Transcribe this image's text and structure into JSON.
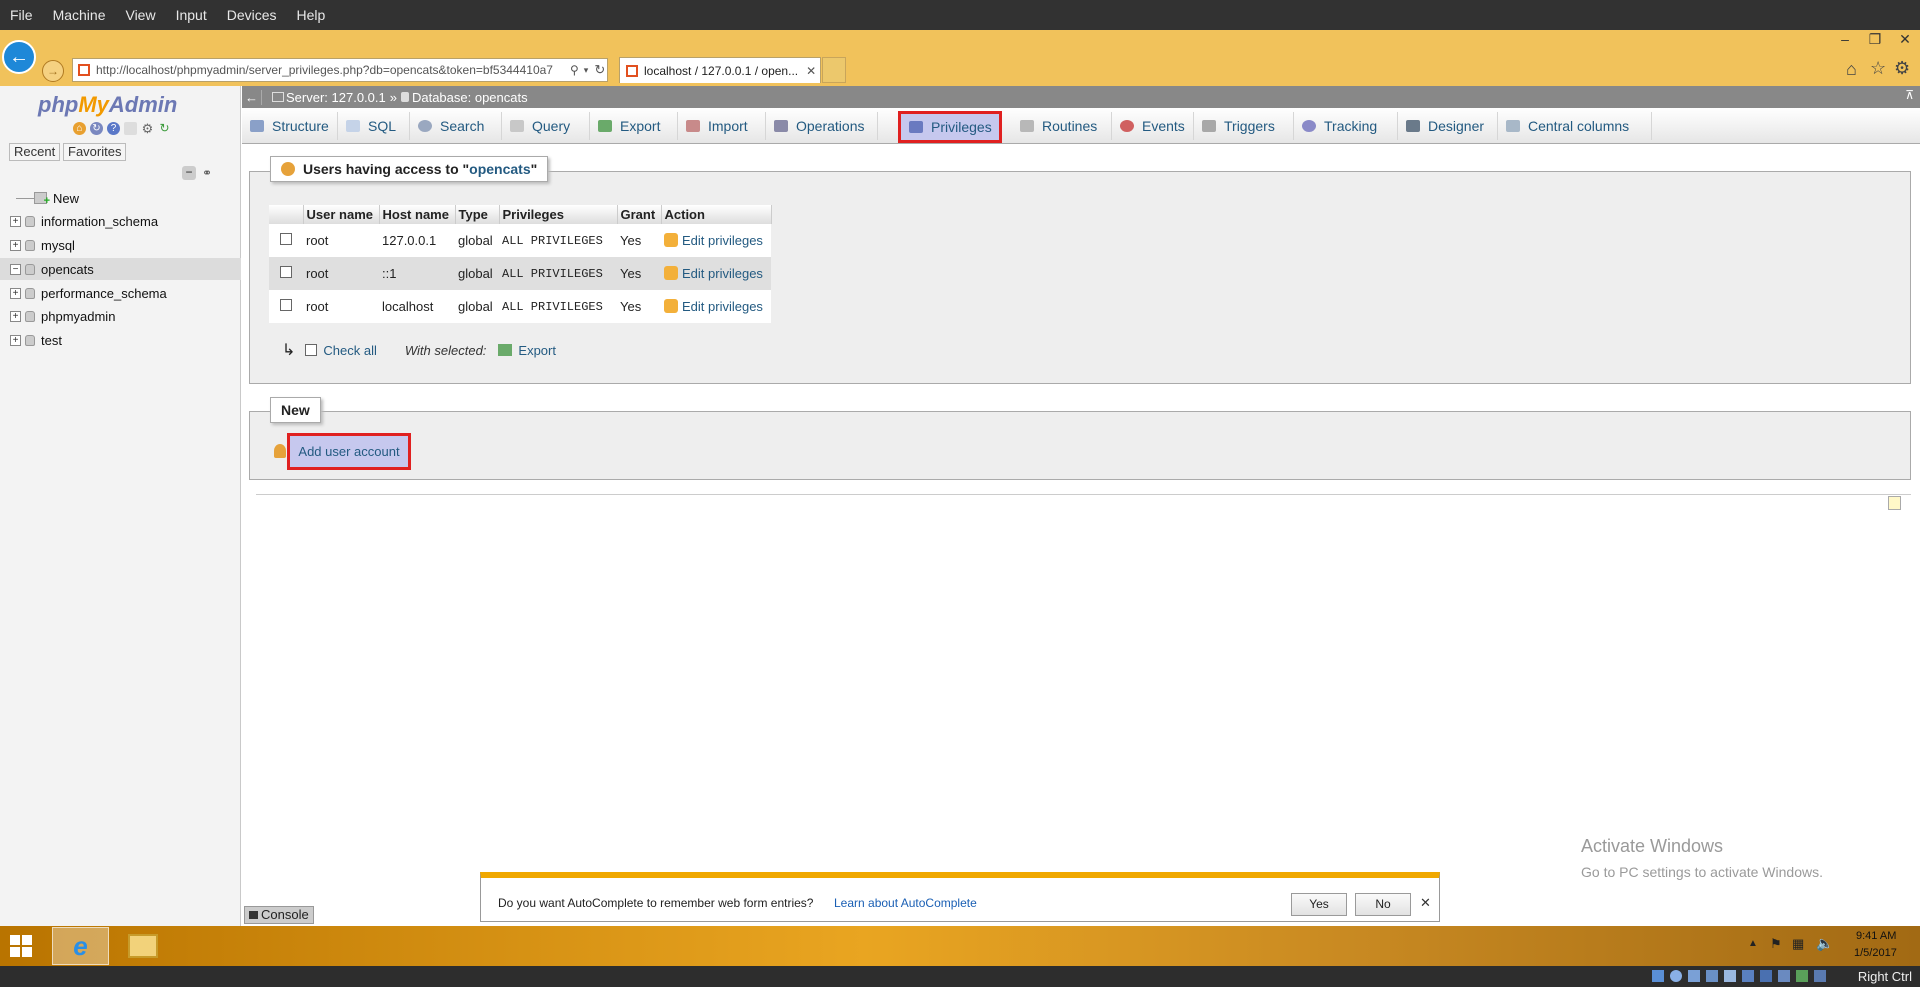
{
  "vm_menu": [
    "File",
    "Machine",
    "View",
    "Input",
    "Devices",
    "Help"
  ],
  "browser": {
    "url": "http://localhost/phpmyadmin/server_privileges.php?db=opencats&token=bf5344410a7",
    "tab_title": "localhost / 127.0.0.1 / open...",
    "caption_buttons": [
      "–",
      "❐",
      "✕"
    ]
  },
  "sidebar": {
    "logo": {
      "php": "php",
      "my": "My",
      "admin": "Admin"
    },
    "tabs": [
      "Recent",
      "Favorites"
    ],
    "items": [
      {
        "label": "New"
      },
      {
        "label": "information_schema"
      },
      {
        "label": "mysql"
      },
      {
        "label": "opencats",
        "selected": true
      },
      {
        "label": "performance_schema"
      },
      {
        "label": "phpmyadmin"
      },
      {
        "label": "test"
      }
    ]
  },
  "breadcrumb": {
    "server": "Server: 127.0.0.1",
    "sep": "»",
    "database": "Database: opencats"
  },
  "menu": [
    {
      "label": "Structure"
    },
    {
      "label": "SQL"
    },
    {
      "label": "Search"
    },
    {
      "label": "Query"
    },
    {
      "label": "Export"
    },
    {
      "label": "Import"
    },
    {
      "label": "Operations"
    },
    {
      "label": "Privileges",
      "active": true
    },
    {
      "label": "Routines"
    },
    {
      "label": "Events"
    },
    {
      "label": "Triggers"
    },
    {
      "label": "Tracking"
    },
    {
      "label": "Designer"
    },
    {
      "label": "Central columns"
    }
  ],
  "users_panel": {
    "legend_prefix": "Users having access to \"",
    "legend_db": "opencats",
    "legend_suffix": "\"",
    "columns": [
      "User name",
      "Host name",
      "Type",
      "Privileges",
      "Grant",
      "Action"
    ],
    "rows": [
      {
        "user": "root",
        "host": "127.0.0.1",
        "type": "global",
        "privileges": "ALL PRIVILEGES",
        "grant": "Yes",
        "action": "Edit privileges"
      },
      {
        "user": "root",
        "host": "::1",
        "type": "global",
        "privileges": "ALL PRIVILEGES",
        "grant": "Yes",
        "action": "Edit privileges"
      },
      {
        "user": "root",
        "host": "localhost",
        "type": "global",
        "privileges": "ALL PRIVILEGES",
        "grant": "Yes",
        "action": "Edit privileges"
      }
    ],
    "check_all": "Check all",
    "with_selected": "With selected:",
    "export": "Export"
  },
  "new_panel": {
    "legend": "New",
    "add_user": "Add user account"
  },
  "console": "Console",
  "watermark": {
    "title": "Activate Windows",
    "subtitle": "Go to PC settings to activate Windows."
  },
  "autocomplete": {
    "question": "Do you want AutoComplete to remember web form entries?",
    "learn": "Learn about AutoComplete",
    "yes": "Yes",
    "no": "No"
  },
  "clock": {
    "time": "9:41 AM",
    "date": "1/5/2017"
  },
  "vm_status": {
    "host_key": "Right Ctrl"
  },
  "colors": {
    "accent": "#235a81",
    "highlight": "#e02020",
    "ie_frame": "#f1c25b",
    "taskbar": "#e9a521"
  }
}
